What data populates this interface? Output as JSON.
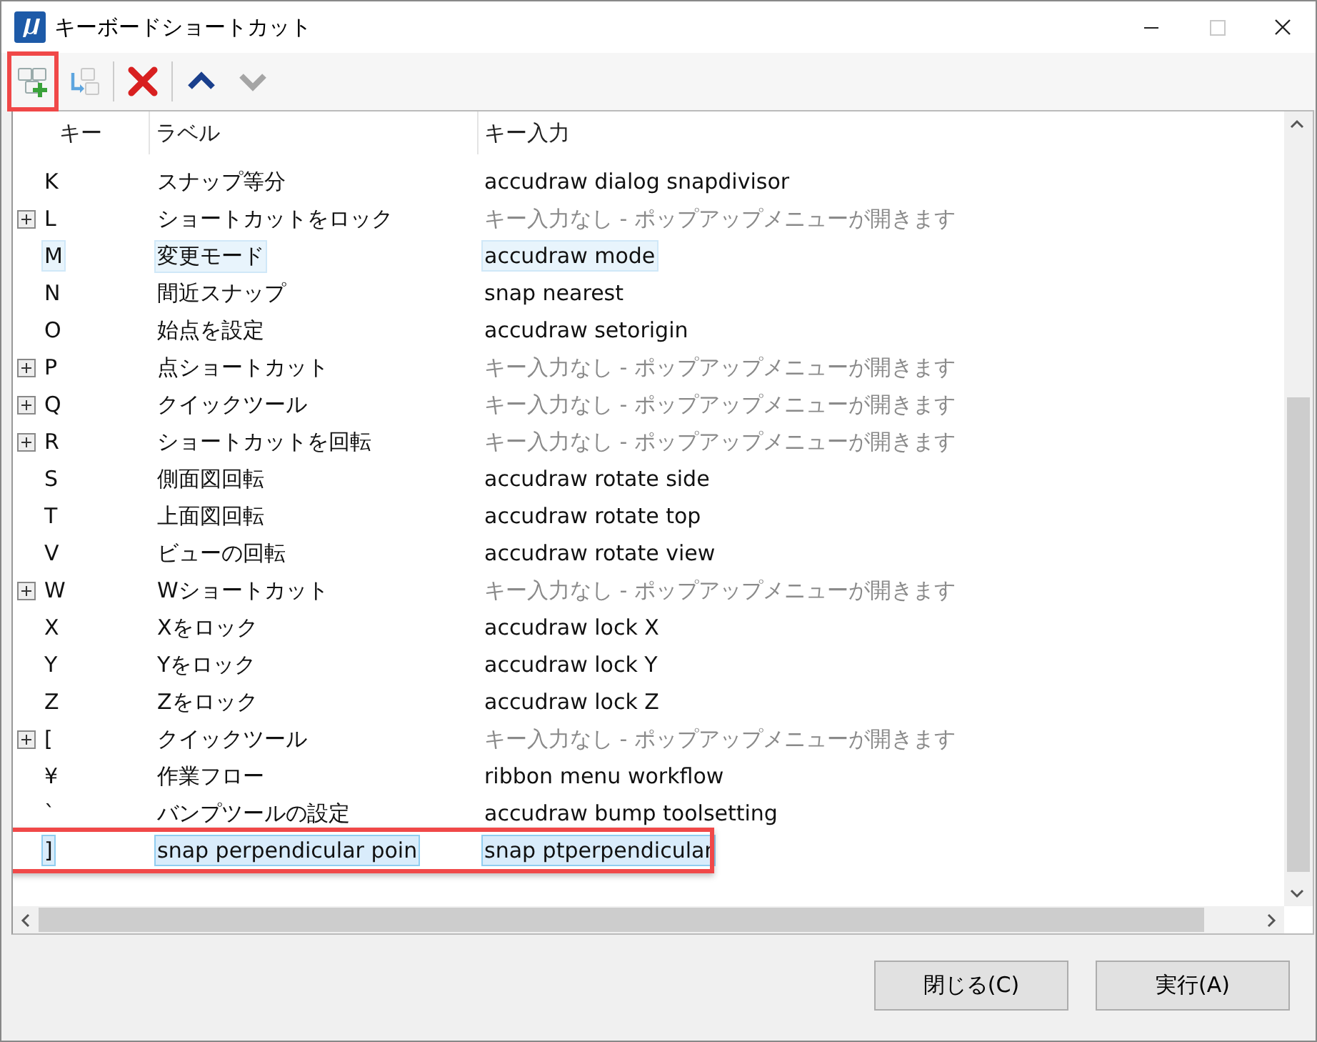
{
  "window": {
    "title": "キーボードショートカット"
  },
  "toolbar": {
    "buttons": [
      {
        "kind": "add",
        "disabled": false,
        "annotated": true
      },
      {
        "kind": "move",
        "disabled": true,
        "annotated": false
      },
      {
        "kind": "delete",
        "disabled": false,
        "annotated": false
      },
      {
        "kind": "up",
        "disabled": false,
        "annotated": false
      },
      {
        "kind": "down",
        "disabled": true,
        "annotated": false
      }
    ]
  },
  "table": {
    "columns": [
      "キー",
      "ラベル",
      "キー入力"
    ],
    "rows": [
      {
        "key": "K",
        "label": "スナップ等分",
        "input": "accudraw dialog snapdivisor",
        "expandable": false,
        "muted": false,
        "selected": false,
        "highlighted": false,
        "annotated": false
      },
      {
        "key": "L",
        "label": "ショートカットをロック",
        "input": "キー入力なし - ポップアップメニューが開きます",
        "expandable": true,
        "muted": true,
        "selected": false,
        "highlighted": false,
        "annotated": false
      },
      {
        "key": "M",
        "label": "変更モード",
        "input": "accudraw mode",
        "expandable": false,
        "muted": false,
        "selected": false,
        "highlighted": true,
        "annotated": false
      },
      {
        "key": "N",
        "label": "間近スナップ",
        "input": "snap nearest",
        "expandable": false,
        "muted": false,
        "selected": false,
        "highlighted": false,
        "annotated": false
      },
      {
        "key": "O",
        "label": "始点を設定",
        "input": "accudraw setorigin",
        "expandable": false,
        "muted": false,
        "selected": false,
        "highlighted": false,
        "annotated": false
      },
      {
        "key": "P",
        "label": "点ショートカット",
        "input": "キー入力なし - ポップアップメニューが開きます",
        "expandable": true,
        "muted": true,
        "selected": false,
        "highlighted": false,
        "annotated": false
      },
      {
        "key": "Q",
        "label": "クイックツール",
        "input": "キー入力なし - ポップアップメニューが開きます",
        "expandable": true,
        "muted": true,
        "selected": false,
        "highlighted": false,
        "annotated": false
      },
      {
        "key": "R",
        "label": "ショートカットを回転",
        "input": "キー入力なし - ポップアップメニューが開きます",
        "expandable": true,
        "muted": true,
        "selected": false,
        "highlighted": false,
        "annotated": false
      },
      {
        "key": "S",
        "label": "側面図回転",
        "input": "accudraw rotate side",
        "expandable": false,
        "muted": false,
        "selected": false,
        "highlighted": false,
        "annotated": false
      },
      {
        "key": "T",
        "label": "上面図回転",
        "input": "accudraw rotate top",
        "expandable": false,
        "muted": false,
        "selected": false,
        "highlighted": false,
        "annotated": false
      },
      {
        "key": "V",
        "label": "ビューの回転",
        "input": "accudraw rotate view",
        "expandable": false,
        "muted": false,
        "selected": false,
        "highlighted": false,
        "annotated": false
      },
      {
        "key": "W",
        "label": "Wショートカット",
        "input": "キー入力なし - ポップアップメニューが開きます",
        "expandable": true,
        "muted": true,
        "selected": false,
        "highlighted": false,
        "annotated": false
      },
      {
        "key": "X",
        "label": "Xをロック",
        "input": "accudraw lock X",
        "expandable": false,
        "muted": false,
        "selected": false,
        "highlighted": false,
        "annotated": false
      },
      {
        "key": "Y",
        "label": "Yをロック",
        "input": "accudraw lock Y",
        "expandable": false,
        "muted": false,
        "selected": false,
        "highlighted": false,
        "annotated": false
      },
      {
        "key": "Z",
        "label": "Zをロック",
        "input": "accudraw lock Z",
        "expandable": false,
        "muted": false,
        "selected": false,
        "highlighted": false,
        "annotated": false
      },
      {
        "key": "[",
        "label": "クイックツール",
        "input": "キー入力なし - ポップアップメニューが開きます",
        "expandable": true,
        "muted": true,
        "selected": false,
        "highlighted": false,
        "annotated": false
      },
      {
        "key": "¥",
        "label": "作業フロー",
        "input": "ribbon menu workflow",
        "expandable": false,
        "muted": false,
        "selected": false,
        "highlighted": false,
        "annotated": false
      },
      {
        "key": "`",
        "label": "バンプツールの設定",
        "input": "accudraw bump toolsetting",
        "expandable": false,
        "muted": false,
        "selected": false,
        "highlighted": false,
        "annotated": false
      },
      {
        "key": "]",
        "label": "snap perpendicular poin",
        "input": "snap ptperpendicular",
        "expandable": false,
        "muted": false,
        "selected": true,
        "highlighted": false,
        "annotated": true
      }
    ]
  },
  "buttons": [
    "閉じる(C)",
    "実行(A)"
  ]
}
